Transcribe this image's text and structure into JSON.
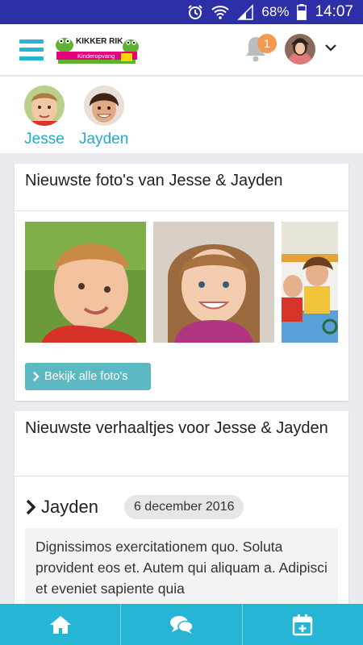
{
  "status_bar": {
    "battery": "68%",
    "time": "14:07"
  },
  "header": {
    "logo": {
      "line1": "KIKKER RIK",
      "line2": "Kinderopvang"
    },
    "notification_count": "1",
    "icons": {
      "menu": "hamburger-menu-icon",
      "bell": "bell-icon",
      "chevron": "chevron-down-icon"
    },
    "accent": "#27b5d6",
    "badge_color": "#f39a50"
  },
  "children": [
    {
      "name": "Jesse"
    },
    {
      "name": "Jayden"
    }
  ],
  "photos_card": {
    "title": "Nieuwste foto's van Jesse & Jayden",
    "button_label": "Bekijk alle foto's",
    "button_color": "#5cb9c3"
  },
  "stories_card": {
    "title": "Nieuwste verhaaltjes voor Jesse & Jayden",
    "story": {
      "child": "Jayden",
      "date": "6 december 2016",
      "text": "Dignissimos exercitationem quo. Soluta provident eos et. Autem qui aliquam a. Adipisci et eveniet sapiente quia"
    }
  },
  "bottom_nav": {
    "items": [
      {
        "icon": "home-icon"
      },
      {
        "icon": "chat-bubbles-icon"
      },
      {
        "icon": "calendar-add-icon"
      }
    ],
    "color": "#27b5d6"
  }
}
